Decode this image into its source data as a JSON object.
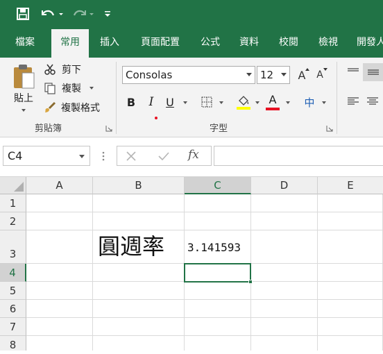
{
  "colors": {
    "accent": "#217346",
    "font_color_bar": "#e81123",
    "highlight_bar": "#ffff00"
  },
  "quick_access": {
    "icons": [
      "save-icon",
      "undo-icon",
      "redo-icon",
      "customize-icon"
    ]
  },
  "tabs": [
    {
      "label": "檔案",
      "active": false
    },
    {
      "label": "常用",
      "active": true
    },
    {
      "label": "插入",
      "active": false
    },
    {
      "label": "頁面配置",
      "active": false
    },
    {
      "label": "公式",
      "active": false
    },
    {
      "label": "資料",
      "active": false
    },
    {
      "label": "校閱",
      "active": false
    },
    {
      "label": "檢視",
      "active": false
    },
    {
      "label": "開發人",
      "active": false
    }
  ],
  "ribbon": {
    "clipboard": {
      "paste_label": "貼上",
      "cut_label": "剪下",
      "copy_label": "複製",
      "format_painter_label": "複製格式",
      "group_label": "剪貼簿"
    },
    "font": {
      "font_name": "Consolas",
      "font_size": "12",
      "bold": "B",
      "italic": "I",
      "underline": "U",
      "font_color_glyph": "A",
      "grow_glyph": "A",
      "shrink_glyph": "A",
      "phonetic_glyph": "中",
      "group_label": "字型"
    }
  },
  "formula_bar": {
    "name_box": "C4",
    "fx_label": "fx",
    "formula": ""
  },
  "grid": {
    "columns": [
      "A",
      "B",
      "C",
      "D",
      "E"
    ],
    "rows": [
      "1",
      "2",
      "3",
      "4",
      "5",
      "6",
      "7",
      "8"
    ],
    "selected_column": "C",
    "selected_row": "4",
    "cells": {
      "B3": "圓週率",
      "C3": "3.141593"
    }
  }
}
